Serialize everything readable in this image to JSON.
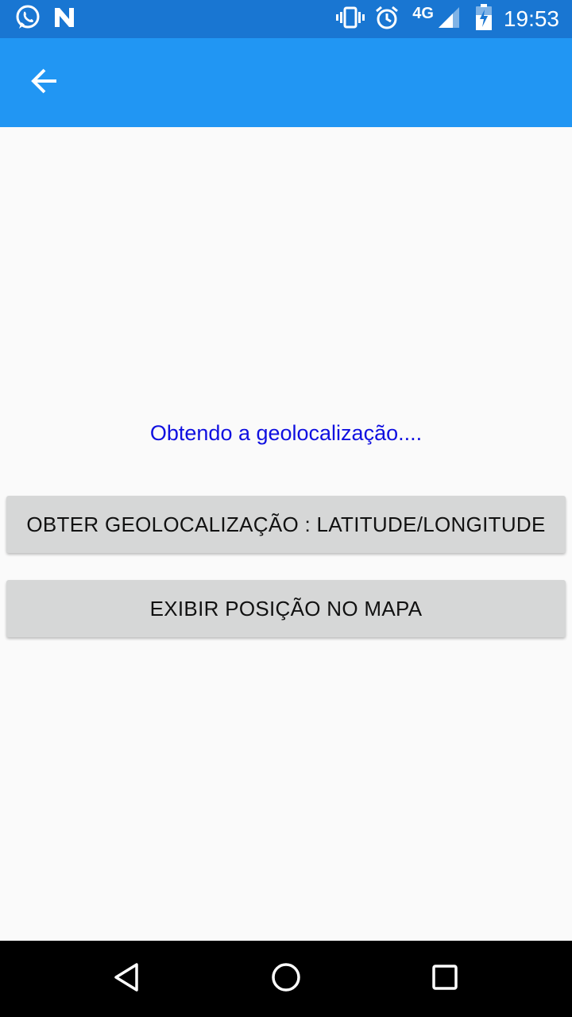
{
  "status_bar": {
    "network_type": "4G",
    "time": "19:53",
    "left_icons": [
      "whatsapp-icon",
      "n-notification-icon"
    ],
    "right_icons": [
      "vibrate-icon",
      "alarm-icon",
      "signal-icon",
      "battery-charging-icon"
    ]
  },
  "app_bar": {
    "background_color": "#2196f3",
    "back_icon": "arrow-left-icon"
  },
  "main": {
    "status_message": "Obtendo a geolocalização....",
    "status_color": "#1010e0",
    "buttons": [
      {
        "label": "OBTER GEOLOCALIZAÇÃO : LATITUDE/LONGITUDE"
      },
      {
        "label": "EXIBIR POSIÇÃO NO MAPA"
      }
    ]
  },
  "nav_bar": {
    "buttons": [
      "back-triangle-icon",
      "home-circle-icon",
      "recents-square-icon"
    ]
  }
}
